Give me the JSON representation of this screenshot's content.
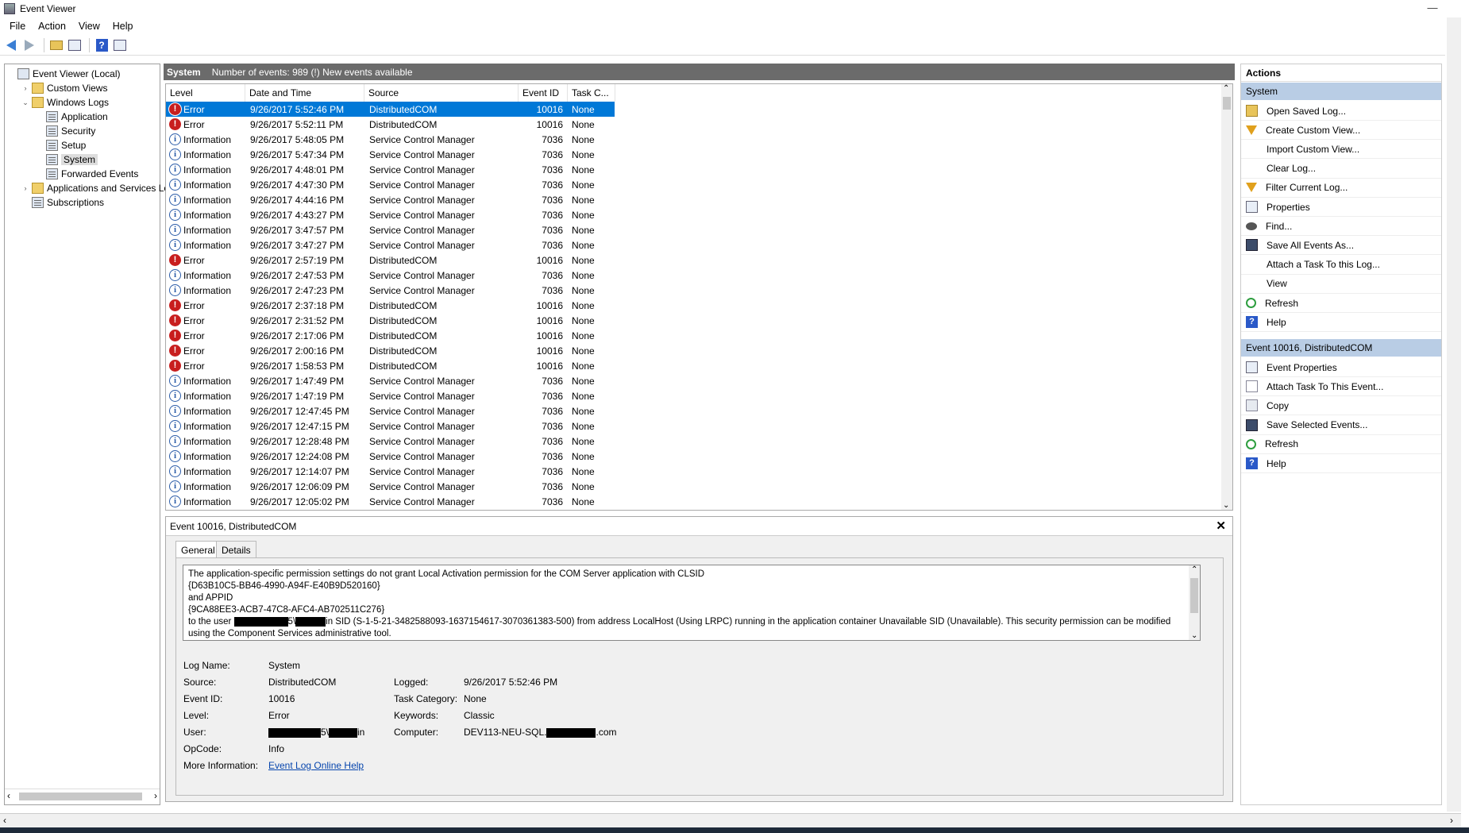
{
  "window": {
    "title": "Event Viewer",
    "minimize": "—",
    "restore": "□",
    "close": "✕"
  },
  "menu": [
    "File",
    "Action",
    "View",
    "Help"
  ],
  "tree": [
    {
      "label": "Event Viewer (Local)",
      "indent": 0,
      "exp": "",
      "icon": "box"
    },
    {
      "label": "Custom Views",
      "indent": 1,
      "exp": "›",
      "icon": "folder"
    },
    {
      "label": "Windows Logs",
      "indent": 1,
      "exp": "⌄",
      "icon": "folder"
    },
    {
      "label": "Application",
      "indent": 2,
      "exp": "",
      "icon": "log"
    },
    {
      "label": "Security",
      "indent": 2,
      "exp": "",
      "icon": "log"
    },
    {
      "label": "Setup",
      "indent": 2,
      "exp": "",
      "icon": "log"
    },
    {
      "label": "System",
      "indent": 2,
      "exp": "",
      "icon": "log",
      "selected": true
    },
    {
      "label": "Forwarded Events",
      "indent": 2,
      "exp": "",
      "icon": "log"
    },
    {
      "label": "Applications and Services Lo",
      "indent": 1,
      "exp": "›",
      "icon": "folder"
    },
    {
      "label": "Subscriptions",
      "indent": 1,
      "exp": "",
      "icon": "log"
    }
  ],
  "center": {
    "title": "System",
    "summary": "Number of events: 989 (!) New events available"
  },
  "columns": [
    "Level",
    "Date and Time",
    "Source",
    "Event ID",
    "Task C..."
  ],
  "events": [
    {
      "level": "Error",
      "date": "9/26/2017 5:52:46 PM",
      "source": "DistributedCOM",
      "id": "10016",
      "task": "None",
      "selected": true
    },
    {
      "level": "Error",
      "date": "9/26/2017 5:52:11 PM",
      "source": "DistributedCOM",
      "id": "10016",
      "task": "None"
    },
    {
      "level": "Information",
      "date": "9/26/2017 5:48:05 PM",
      "source": "Service Control Manager",
      "id": "7036",
      "task": "None"
    },
    {
      "level": "Information",
      "date": "9/26/2017 5:47:34 PM",
      "source": "Service Control Manager",
      "id": "7036",
      "task": "None"
    },
    {
      "level": "Information",
      "date": "9/26/2017 4:48:01 PM",
      "source": "Service Control Manager",
      "id": "7036",
      "task": "None"
    },
    {
      "level": "Information",
      "date": "9/26/2017 4:47:30 PM",
      "source": "Service Control Manager",
      "id": "7036",
      "task": "None"
    },
    {
      "level": "Information",
      "date": "9/26/2017 4:44:16 PM",
      "source": "Service Control Manager",
      "id": "7036",
      "task": "None"
    },
    {
      "level": "Information",
      "date": "9/26/2017 4:43:27 PM",
      "source": "Service Control Manager",
      "id": "7036",
      "task": "None"
    },
    {
      "level": "Information",
      "date": "9/26/2017 3:47:57 PM",
      "source": "Service Control Manager",
      "id": "7036",
      "task": "None"
    },
    {
      "level": "Information",
      "date": "9/26/2017 3:47:27 PM",
      "source": "Service Control Manager",
      "id": "7036",
      "task": "None"
    },
    {
      "level": "Error",
      "date": "9/26/2017 2:57:19 PM",
      "source": "DistributedCOM",
      "id": "10016",
      "task": "None"
    },
    {
      "level": "Information",
      "date": "9/26/2017 2:47:53 PM",
      "source": "Service Control Manager",
      "id": "7036",
      "task": "None"
    },
    {
      "level": "Information",
      "date": "9/26/2017 2:47:23 PM",
      "source": "Service Control Manager",
      "id": "7036",
      "task": "None"
    },
    {
      "level": "Error",
      "date": "9/26/2017 2:37:18 PM",
      "source": "DistributedCOM",
      "id": "10016",
      "task": "None"
    },
    {
      "level": "Error",
      "date": "9/26/2017 2:31:52 PM",
      "source": "DistributedCOM",
      "id": "10016",
      "task": "None"
    },
    {
      "level": "Error",
      "date": "9/26/2017 2:17:06 PM",
      "source": "DistributedCOM",
      "id": "10016",
      "task": "None"
    },
    {
      "level": "Error",
      "date": "9/26/2017 2:00:16 PM",
      "source": "DistributedCOM",
      "id": "10016",
      "task": "None"
    },
    {
      "level": "Error",
      "date": "9/26/2017 1:58:53 PM",
      "source": "DistributedCOM",
      "id": "10016",
      "task": "None"
    },
    {
      "level": "Information",
      "date": "9/26/2017 1:47:49 PM",
      "source": "Service Control Manager",
      "id": "7036",
      "task": "None"
    },
    {
      "level": "Information",
      "date": "9/26/2017 1:47:19 PM",
      "source": "Service Control Manager",
      "id": "7036",
      "task": "None"
    },
    {
      "level": "Information",
      "date": "9/26/2017 12:47:45 PM",
      "source": "Service Control Manager",
      "id": "7036",
      "task": "None"
    },
    {
      "level": "Information",
      "date": "9/26/2017 12:47:15 PM",
      "source": "Service Control Manager",
      "id": "7036",
      "task": "None"
    },
    {
      "level": "Information",
      "date": "9/26/2017 12:28:48 PM",
      "source": "Service Control Manager",
      "id": "7036",
      "task": "None"
    },
    {
      "level": "Information",
      "date": "9/26/2017 12:24:08 PM",
      "source": "Service Control Manager",
      "id": "7036",
      "task": "None"
    },
    {
      "level": "Information",
      "date": "9/26/2017 12:14:07 PM",
      "source": "Service Control Manager",
      "id": "7036",
      "task": "None"
    },
    {
      "level": "Information",
      "date": "9/26/2017 12:06:09 PM",
      "source": "Service Control Manager",
      "id": "7036",
      "task": "None"
    },
    {
      "level": "Information",
      "date": "9/26/2017 12:05:02 PM",
      "source": "Service Control Manager",
      "id": "7036",
      "task": "None"
    }
  ],
  "detail": {
    "title": "Event 10016, DistributedCOM",
    "tabs": [
      "General",
      "Details"
    ],
    "message": {
      "line1": "The application-specific permission settings do not grant Local Activation permission for the COM Server application with CLSID",
      "line2": "{D63B10C5-BB46-4990-A94F-E40B9D520160}",
      "line3": " and APPID",
      "line4": "{9CA88EE3-ACB7-47C8-AFC4-AB702511C276}",
      "line5a": " to the user ",
      "line5b": "5\\",
      "line5c": "in SID (S-1-5-21-3482588093-1637154617-3070361383-500) from address LocalHost (Using LRPC) running in the application container Unavailable SID (Unavailable). This security permission can be modified",
      "line6": "using the Component Services administrative tool."
    },
    "fields": {
      "log_name_label": "Log Name:",
      "log_name": "System",
      "source_label": "Source:",
      "source": "DistributedCOM",
      "logged_label": "Logged:",
      "logged": "9/26/2017 5:52:46 PM",
      "event_id_label": "Event ID:",
      "event_id": "10016",
      "task_cat_label": "Task Category:",
      "task_cat": "None",
      "level_label": "Level:",
      "level": "Error",
      "keywords_label": "Keywords:",
      "keywords": "Classic",
      "user_label": "User:",
      "user_mid": "5\\",
      "user_end": "in",
      "computer_label": "Computer:",
      "computer_pre": "DEV113-NEU-SQL.",
      "computer_post": ".com",
      "opcode_label": "OpCode:",
      "opcode": "Info",
      "more_label": "More Information:",
      "more_link": "Event Log Online Help"
    }
  },
  "actions": {
    "header": "Actions",
    "section1": "System",
    "items1": [
      {
        "label": "Open Saved Log...",
        "icon": "folder-icon"
      },
      {
        "label": "Create Custom View...",
        "icon": "filter-icon"
      },
      {
        "label": "Import Custom View...",
        "icon": "blank"
      },
      {
        "label": "Clear Log...",
        "icon": "blank"
      },
      {
        "label": "Filter Current Log...",
        "icon": "filter-icon"
      },
      {
        "label": "Properties",
        "icon": "properties-icon"
      },
      {
        "label": "Find...",
        "icon": "binoculars-icon"
      },
      {
        "label": "Save All Events As...",
        "icon": "save-icon"
      },
      {
        "label": "Attach a Task To this Log...",
        "icon": "blank"
      },
      {
        "label": "View",
        "icon": "blank"
      },
      {
        "label": "Refresh",
        "icon": "refresh-icon"
      },
      {
        "label": "Help",
        "icon": "help-icon"
      }
    ],
    "section2": "Event 10016, DistributedCOM",
    "items2": [
      {
        "label": "Event Properties",
        "icon": "properties-icon"
      },
      {
        "label": "Attach Task To This Event...",
        "icon": "task-icon"
      },
      {
        "label": "Copy",
        "icon": "copy-icon"
      },
      {
        "label": "Save Selected Events...",
        "icon": "save-icon"
      },
      {
        "label": "Refresh",
        "icon": "refresh-icon"
      },
      {
        "label": "Help",
        "icon": "help-icon"
      }
    ]
  }
}
